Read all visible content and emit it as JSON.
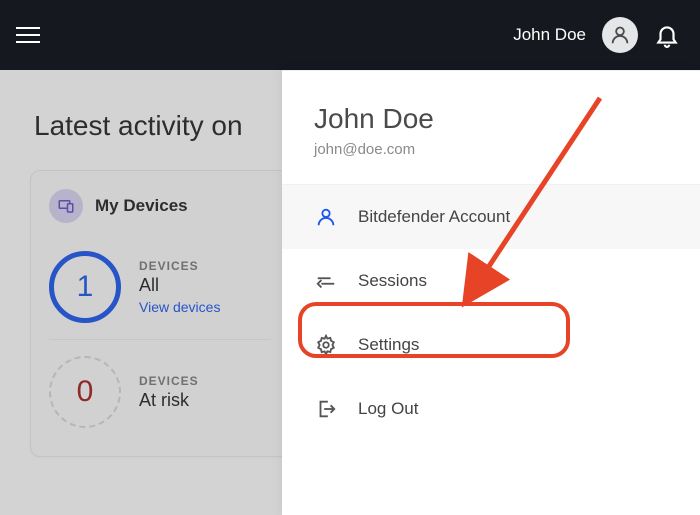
{
  "header": {
    "username": "John Doe"
  },
  "page": {
    "title": "Latest activity on"
  },
  "devices": {
    "card_title": "My Devices",
    "rows": [
      {
        "count": "1",
        "label": "DEVICES",
        "sub": "All",
        "link": "View devices"
      },
      {
        "count": "0",
        "label": "DEVICES",
        "sub": "At risk"
      }
    ]
  },
  "dropdown": {
    "name": "John Doe",
    "email": "john@doe.com",
    "items": [
      {
        "label": "Bitdefender Account"
      },
      {
        "label": "Sessions"
      },
      {
        "label": "Settings"
      },
      {
        "label": "Log Out"
      }
    ]
  }
}
